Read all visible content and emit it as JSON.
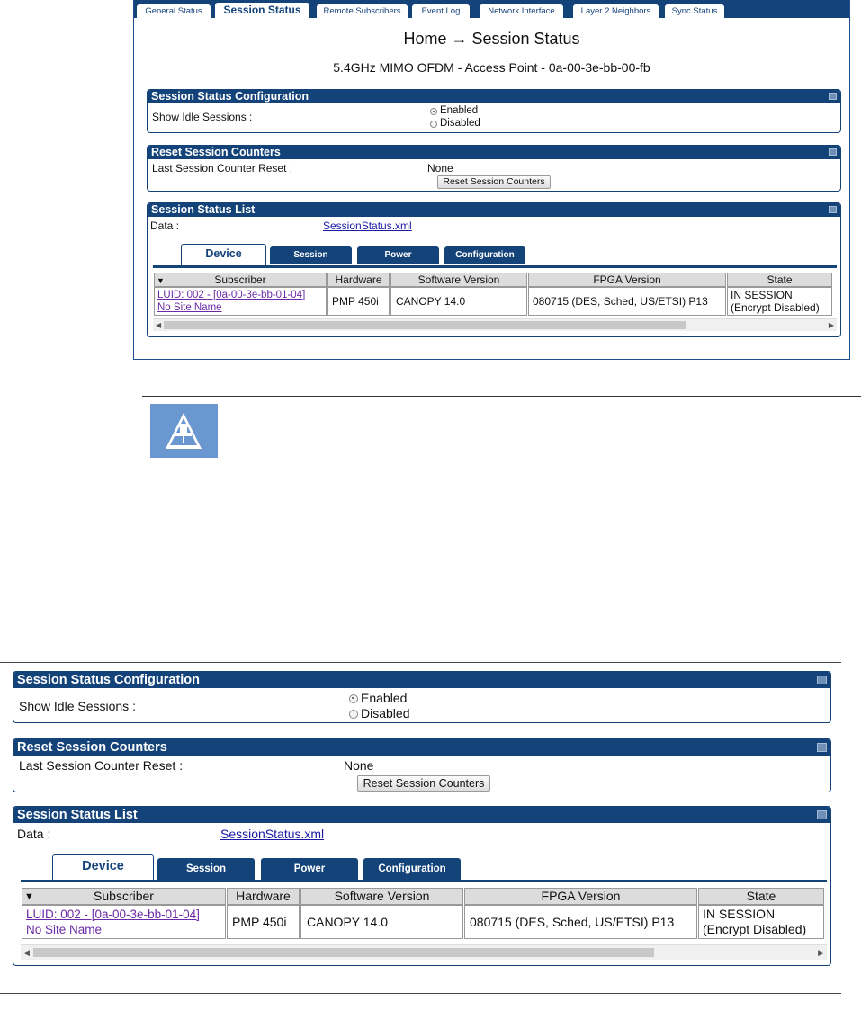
{
  "tabs": [
    {
      "label": "General Status"
    },
    {
      "label": "Session Status"
    },
    {
      "label": "Remote Subscribers"
    },
    {
      "label": "Event Log"
    },
    {
      "label": "Network Interface"
    },
    {
      "label": "Layer 2 Neighbors"
    },
    {
      "label": "Sync Status"
    }
  ],
  "header": {
    "breadcrumb": "Home → Session Status",
    "subtitle": "5.4GHz MIMO OFDM - Access Point - 0a-00-3e-bb-00-fb"
  },
  "config_panel": {
    "title": "Session Status Configuration",
    "label": "Show Idle Sessions :",
    "options": [
      "Enabled",
      "Disabled"
    ],
    "selected": "Enabled"
  },
  "reset_panel": {
    "title": "Reset Session Counters",
    "label": "Last Session Counter Reset :",
    "value": "None",
    "button": "Reset Session Counters"
  },
  "list_panel": {
    "title": "Session Status List",
    "data_label": "Data :",
    "data_link": "SessionStatus.xml",
    "subtabs": [
      "Device",
      "Session",
      "Power",
      "Configuration"
    ],
    "columns": [
      "Subscriber",
      "Hardware",
      "Software Version",
      "FPGA Version",
      "State"
    ],
    "row": {
      "subscriber_line1": "LUID: 002 - [0a-00-3e-bb-01-04]",
      "subscriber_line2": "No Site Name",
      "hardware": "PMP 450i",
      "software": "CANOPY 14.0",
      "fpga": "080715 (DES, Sched, US/ETSI) P13",
      "state_line1": "IN SESSION",
      "state_line2": "(Encrypt Disabled)"
    }
  },
  "colors": {
    "brand": "#14437a",
    "note_icon": "#6b97d0",
    "link": "#1a1aa6"
  },
  "icons": [
    "pushpin-icon",
    "minimize-icon",
    "sort-desc-icon",
    "scroll-left-icon",
    "scroll-right-icon"
  ]
}
